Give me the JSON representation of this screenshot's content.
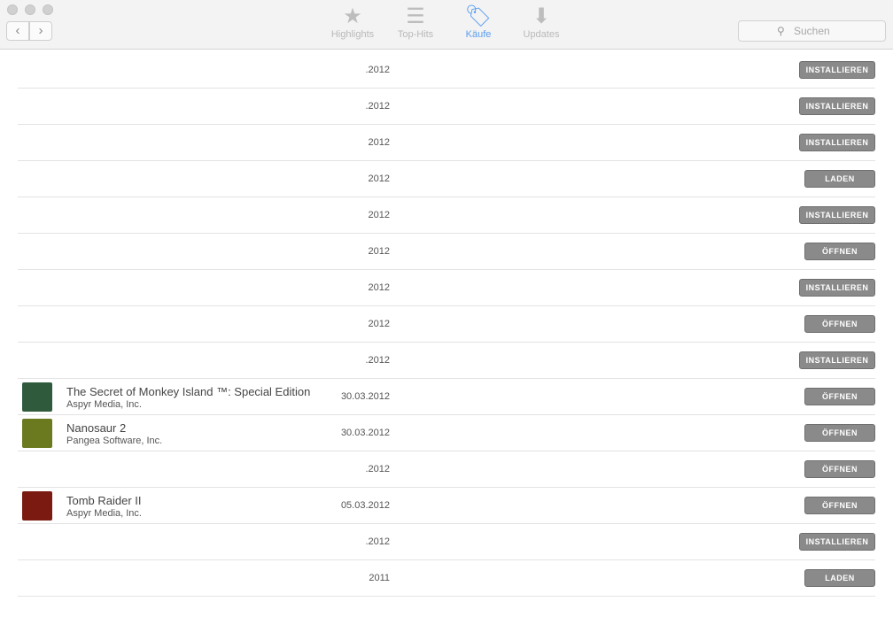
{
  "toolbar": {
    "tabs": [
      {
        "label": "Highlights",
        "icon": "star-icon"
      },
      {
        "label": "Top-Hits",
        "icon": "list-icon"
      },
      {
        "label": "Käufe",
        "icon": "tag-icon"
      },
      {
        "label": "Updates",
        "icon": "download-icon"
      }
    ],
    "search_placeholder": "Suchen"
  },
  "rows": [
    {
      "date": ".2012",
      "button": "INSTALLIEREN"
    },
    {
      "date": ".2012",
      "button": "INSTALLIEREN"
    },
    {
      "date": "2012",
      "button": "INSTALLIEREN"
    },
    {
      "date": "2012",
      "button": "LADEN"
    },
    {
      "date": "2012",
      "button": "INSTALLIEREN"
    },
    {
      "date": "2012",
      "button": "ÖFFNEN"
    },
    {
      "date": "2012",
      "button": "INSTALLIEREN"
    },
    {
      "date": "2012",
      "button": "ÖFFNEN"
    },
    {
      "date": ".2012",
      "button": "INSTALLIEREN"
    },
    {
      "name": "The Secret of Monkey Island ™: Special Edition",
      "developer": "Aspyr Media, Inc.",
      "date": "30.03.2012",
      "button": "ÖFFNEN",
      "icon_color": "#2f5a3c"
    },
    {
      "name": "Nanosaur 2",
      "developer": "Pangea Software, Inc.",
      "date": "30.03.2012",
      "button": "ÖFFNEN",
      "icon_color": "#6b7a1e"
    },
    {
      "date": ".2012",
      "button": "ÖFFNEN"
    },
    {
      "name": "Tomb Raider II",
      "developer": "Aspyr Media, Inc.",
      "date": "05.03.2012",
      "button": "ÖFFNEN",
      "icon_color": "#7a1a10"
    },
    {
      "date": ".2012",
      "button": "INSTALLIEREN"
    },
    {
      "date": "2011",
      "button": "LADEN"
    }
  ]
}
